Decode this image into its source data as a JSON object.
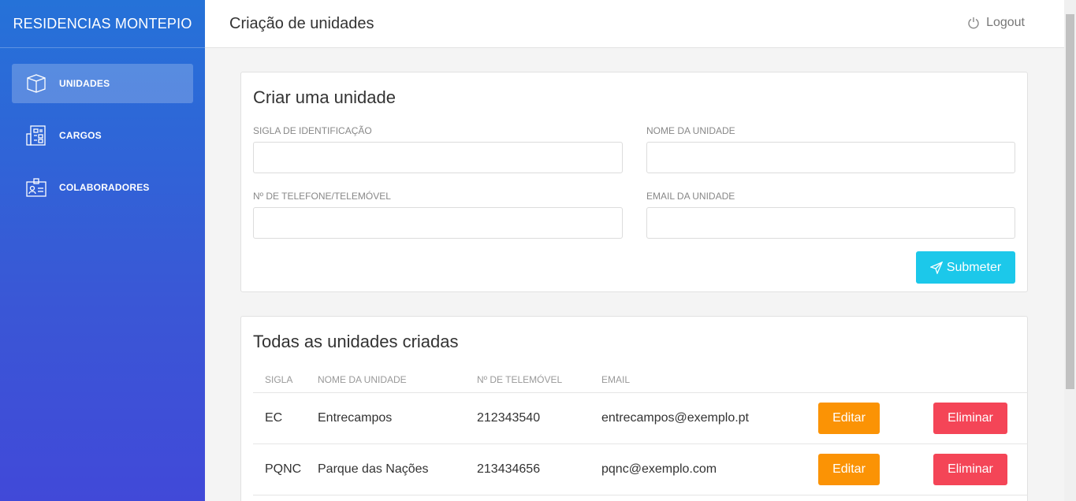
{
  "app": {
    "brand": "RESIDENCIAS MONTEPIO"
  },
  "sidebar": {
    "items": [
      {
        "label": "UNIDADES",
        "icon": "cube-icon",
        "active": true
      },
      {
        "label": "CARGOS",
        "icon": "building-icon",
        "active": false
      },
      {
        "label": "COLABORADORES",
        "icon": "id-card-icon",
        "active": false
      }
    ]
  },
  "header": {
    "title": "Criação de unidades",
    "logout_label": "Logout"
  },
  "form": {
    "title": "Criar uma unidade",
    "fields": {
      "sigla": {
        "label": "SIGLA DE IDENTIFICAÇÃO",
        "value": ""
      },
      "nome": {
        "label": "NOME DA UNIDADE",
        "value": ""
      },
      "telefone": {
        "label": "Nº DE TELEFONE/TELEMÓVEL",
        "value": ""
      },
      "email": {
        "label": "EMAIL DA UNIDADE",
        "value": ""
      }
    },
    "submit_label": "Submeter"
  },
  "list": {
    "title": "Todas as unidades criadas",
    "columns": [
      "SIGLA",
      "NOME DA UNIDADE",
      "Nº DE TELEMÓVEL",
      "EMAIL"
    ],
    "rows": [
      {
        "sigla": "EC",
        "nome": "Entrecampos",
        "telefone": "212343540",
        "email": "entrecampos@exemplo.pt",
        "edit_label": "Editar",
        "delete_label": "Eliminar"
      },
      {
        "sigla": "PQNC",
        "nome": "Parque das Nações",
        "telefone": "213434656",
        "email": "pqnc@exemplo.com",
        "edit_label": "Editar",
        "delete_label": "Eliminar"
      }
    ]
  },
  "colors": {
    "accent_submit": "#1cc8ea",
    "edit": "#fb9305",
    "delete": "#f44557",
    "sidebar_top": "#2572d8",
    "sidebar_bottom": "#4149d8"
  }
}
